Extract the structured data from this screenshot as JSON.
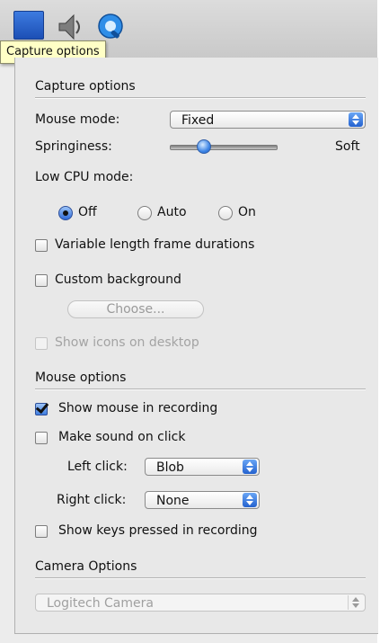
{
  "toolbar": {
    "items": [
      {
        "name": "capture-options-tool",
        "icon": "blue-square-icon"
      },
      {
        "name": "sound-tool",
        "icon": "speaker-icon"
      },
      {
        "name": "quicktime-tool",
        "icon": "quicktime-icon"
      }
    ],
    "tooltip": "Capture options"
  },
  "capture": {
    "section_title": "Capture options",
    "mouse_mode_label": "Mouse mode:",
    "mouse_mode_value": "Fixed",
    "springiness_label": "Springiness:",
    "springiness_value_label": "Soft",
    "springiness_level": 0.25,
    "low_cpu_label": "Low CPU mode:",
    "low_cpu_options": [
      "Off",
      "Auto",
      "On"
    ],
    "low_cpu_selected": "Off",
    "variable_frames_label": "Variable length frame durations",
    "variable_frames_checked": false,
    "custom_background_label": "Custom background",
    "custom_background_checked": false,
    "choose_button_label": "Choose...",
    "show_icons_label": "Show icons on desktop",
    "show_icons_checked": false
  },
  "mouse": {
    "section_title": "Mouse options",
    "show_mouse_label": "Show mouse in recording",
    "show_mouse_checked": true,
    "make_sound_label": "Make sound on click",
    "make_sound_checked": false,
    "left_click_label": "Left click:",
    "left_click_value": "Blob",
    "right_click_label": "Right click:",
    "right_click_value": "None",
    "show_keys_label": "Show keys pressed in recording",
    "show_keys_checked": false
  },
  "camera": {
    "section_title": "Camera Options",
    "camera_value": "Logitech Camera"
  },
  "colors": {
    "accent": "#3f7de0",
    "panel_bg": "#e8e8e8",
    "tooltip_bg": "#ffffc6"
  }
}
